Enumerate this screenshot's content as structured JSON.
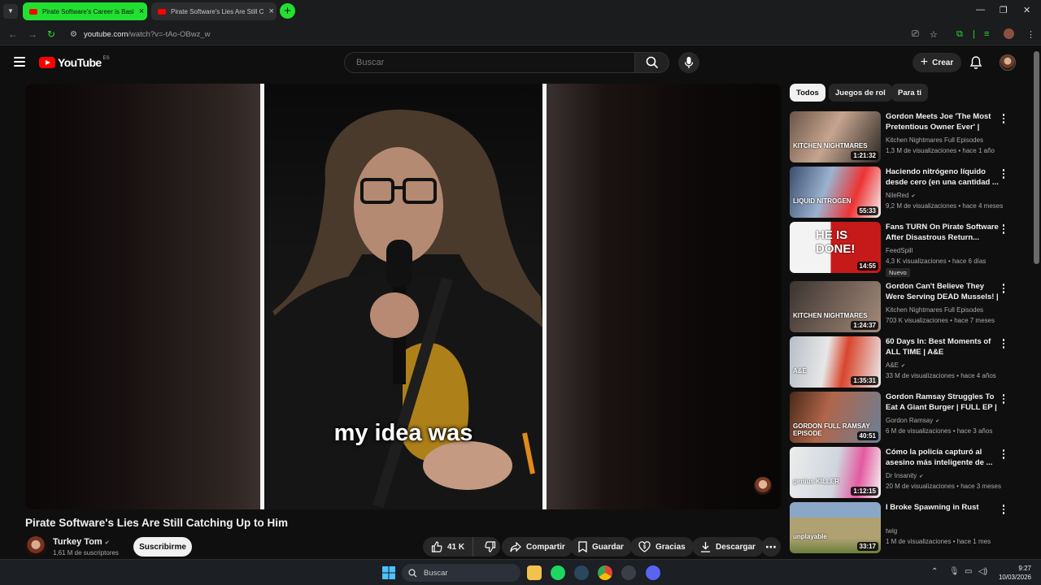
{
  "browser": {
    "tabs": [
      {
        "label": "Pirate Software's Career is Basi"
      },
      {
        "label": "Pirate Software's Lies Are Still C"
      }
    ],
    "url_host": "youtube.com",
    "url_path": "/watch?v=-tAo-OBwz_w"
  },
  "header": {
    "logo_text": "YouTube",
    "country": "ES",
    "search_placeholder": "Buscar",
    "create_label": "Crear"
  },
  "player": {
    "caption": "my idea was"
  },
  "video": {
    "title": "Pirate Software's Lies Are Still Catching Up to Him",
    "channel": "Turkey Tom",
    "subscribers": "1,61 M de suscriptores",
    "subscribe_label": "Suscribirme",
    "likes": "41 K",
    "share_label": "Compartir",
    "save_label": "Guardar",
    "thanks_label": "Gracias",
    "download_label": "Descargar"
  },
  "chips": [
    "Todos",
    "Juegos de rol",
    "Para ti"
  ],
  "recs": [
    {
      "title": "Gordon Meets Joe 'The Most Pretentious Owner Ever' | FULL...",
      "channel": "Kitchen Nightmares Full Episodes",
      "verified": false,
      "views": "1,3 M de visualizaciones",
      "age": "hace 1 año",
      "duration": "1:21:32",
      "thumb_text": "KITCHEN NIGHTMARES",
      "badge": ""
    },
    {
      "title": "Haciendo nitrógeno líquido desde cero (en una cantidad ...",
      "channel": "NileRed",
      "verified": true,
      "views": "9,2 M de visualizaciones",
      "age": "hace 4 meses",
      "duration": "55:33",
      "thumb_text": "LIQUID NITROGEN",
      "badge": ""
    },
    {
      "title": "Fans TURN On Pirate Software After Disastrous Return...",
      "channel": "FeedSpill",
      "verified": false,
      "views": "4,3 K visualizaciones",
      "age": "hace 6 días",
      "duration": "14:55",
      "thumb_text": "HE IS DONE!",
      "badge": "Nuevo"
    },
    {
      "title": "Gordon Can't Believe They Were Serving DEAD Mussels! | FULL ...",
      "channel": "Kitchen Nightmares Full Episodes",
      "verified": false,
      "views": "703 K visualizaciones",
      "age": "hace 7 meses",
      "duration": "1:24:37",
      "thumb_text": "KITCHEN NIGHTMARES",
      "badge": ""
    },
    {
      "title": "60 Days In: Best Moments of ALL TIME | A&E",
      "channel": "A&E",
      "verified": true,
      "views": "33 M de visualizaciones",
      "age": "hace 4 años",
      "duration": "1:35:31",
      "thumb_text": "A&E",
      "badge": ""
    },
    {
      "title": "Gordon Ramsay Struggles To Eat A Giant Burger | FULL EP | ...",
      "channel": "Gordon Ramsay",
      "verified": true,
      "views": "6 M de visualizaciones",
      "age": "hace 3 años",
      "duration": "40:51",
      "thumb_text": "GORDON FULL RAMSAY EPISODE",
      "badge": ""
    },
    {
      "title": "Cómo la policía capturó al asesino más inteligente de ...",
      "channel": "Dr Insanity",
      "verified": true,
      "views": "20 M de visualizaciones",
      "age": "hace 3 meses",
      "duration": "1:12:15",
      "thumb_text": "genius KILLER",
      "badge": ""
    },
    {
      "title": "I Broke Spawning in Rust",
      "channel": "twig",
      "verified": false,
      "views": "1 M de visualizaciones",
      "age": "hace 1 mes",
      "duration": "33:17",
      "thumb_text": "unplayable",
      "badge": ""
    }
  ],
  "taskbar": {
    "search_label": "Buscar",
    "time": "9:27",
    "date": "10/03/2026"
  },
  "colors": {
    "background": "#0f0f0f",
    "tab_active": "#22e031",
    "youtube_red": "#ff0000",
    "chip_selected": "#f1f1f1"
  }
}
